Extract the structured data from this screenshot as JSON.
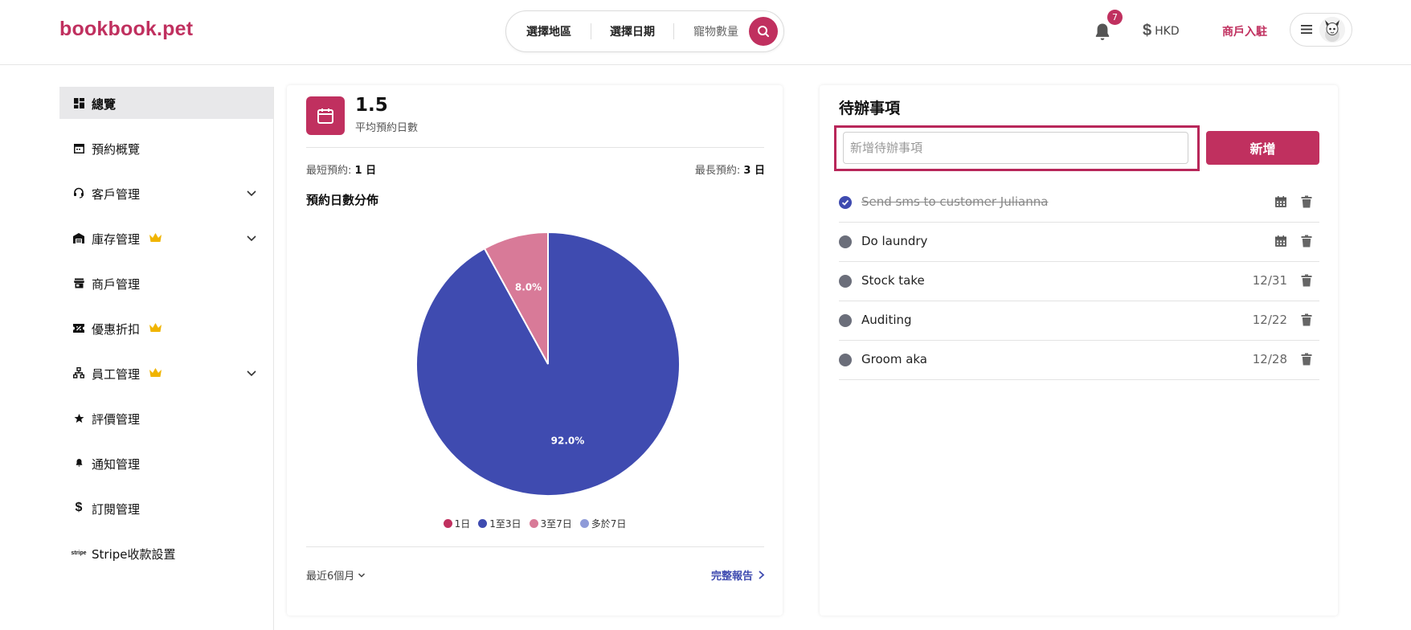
{
  "brand": {
    "logo": "bookbook.pet",
    "accent": "#c0305f",
    "secondary": "#3f4bb0"
  },
  "header": {
    "search": {
      "region": "選擇地區",
      "date": "選擇日期",
      "pets": "寵物數量",
      "icon": "search-icon"
    },
    "notifications": {
      "count": "7",
      "icon": "bell-icon"
    },
    "currency": "HKD",
    "merchant_join": "商戶入駐",
    "user_menu": {
      "icon": "hamburger-icon",
      "avatar": "avatar"
    }
  },
  "sidebar": {
    "items": [
      {
        "label": "總覽",
        "icon": "dashboard-icon",
        "active": true
      },
      {
        "label": "預約概覽",
        "icon": "calendar-icon"
      },
      {
        "label": "客戶管理",
        "icon": "headset-icon",
        "expandable": true
      },
      {
        "label": "庫存管理",
        "icon": "warehouse-icon",
        "premium": true,
        "expandable": true
      },
      {
        "label": "商戶管理",
        "icon": "store-icon"
      },
      {
        "label": "優惠折扣",
        "icon": "ticket-icon",
        "premium": true
      },
      {
        "label": "員工管理",
        "icon": "org-chart-icon",
        "premium": true,
        "expandable": true
      },
      {
        "label": "評價管理",
        "icon": "star-icon"
      },
      {
        "label": "通知管理",
        "icon": "bell-icon"
      },
      {
        "label": "訂閱管理",
        "icon": "dollar-icon"
      },
      {
        "label": "Stripe收款設置",
        "icon": "stripe-icon"
      }
    ]
  },
  "stats": {
    "avg_value": "1.5",
    "avg_label": "平均預約日數",
    "min_label": "最短預約:",
    "min_value": "1 日",
    "max_label": "最長預約:",
    "max_value": "3 日",
    "dist_title": "預約日數分佈",
    "period": "最近6個月",
    "full_report": "完整報告"
  },
  "chart_data": {
    "type": "pie",
    "categories": [
      "1日",
      "1至3日",
      "3至7日",
      "多於7日"
    ],
    "values": [
      0,
      92.0,
      8.0,
      0
    ],
    "colors": [
      "#c0305f",
      "#3f4bb0",
      "#d87a98",
      "#8f9bd8"
    ],
    "data_labels": [
      "",
      "92.0%",
      "8.0%",
      ""
    ],
    "legend_position": "bottom"
  },
  "todo": {
    "title": "待辦事項",
    "input_placeholder": "新增待辦事項",
    "add_label": "新增",
    "items": [
      {
        "text": "Send sms to customer Julianna",
        "done": true,
        "date": ""
      },
      {
        "text": "Do laundry",
        "done": false,
        "date": ""
      },
      {
        "text": "Stock take",
        "done": false,
        "date": "12/31"
      },
      {
        "text": "Auditing",
        "done": false,
        "date": "12/22"
      },
      {
        "text": "Groom aka",
        "done": false,
        "date": "12/28"
      }
    ]
  }
}
